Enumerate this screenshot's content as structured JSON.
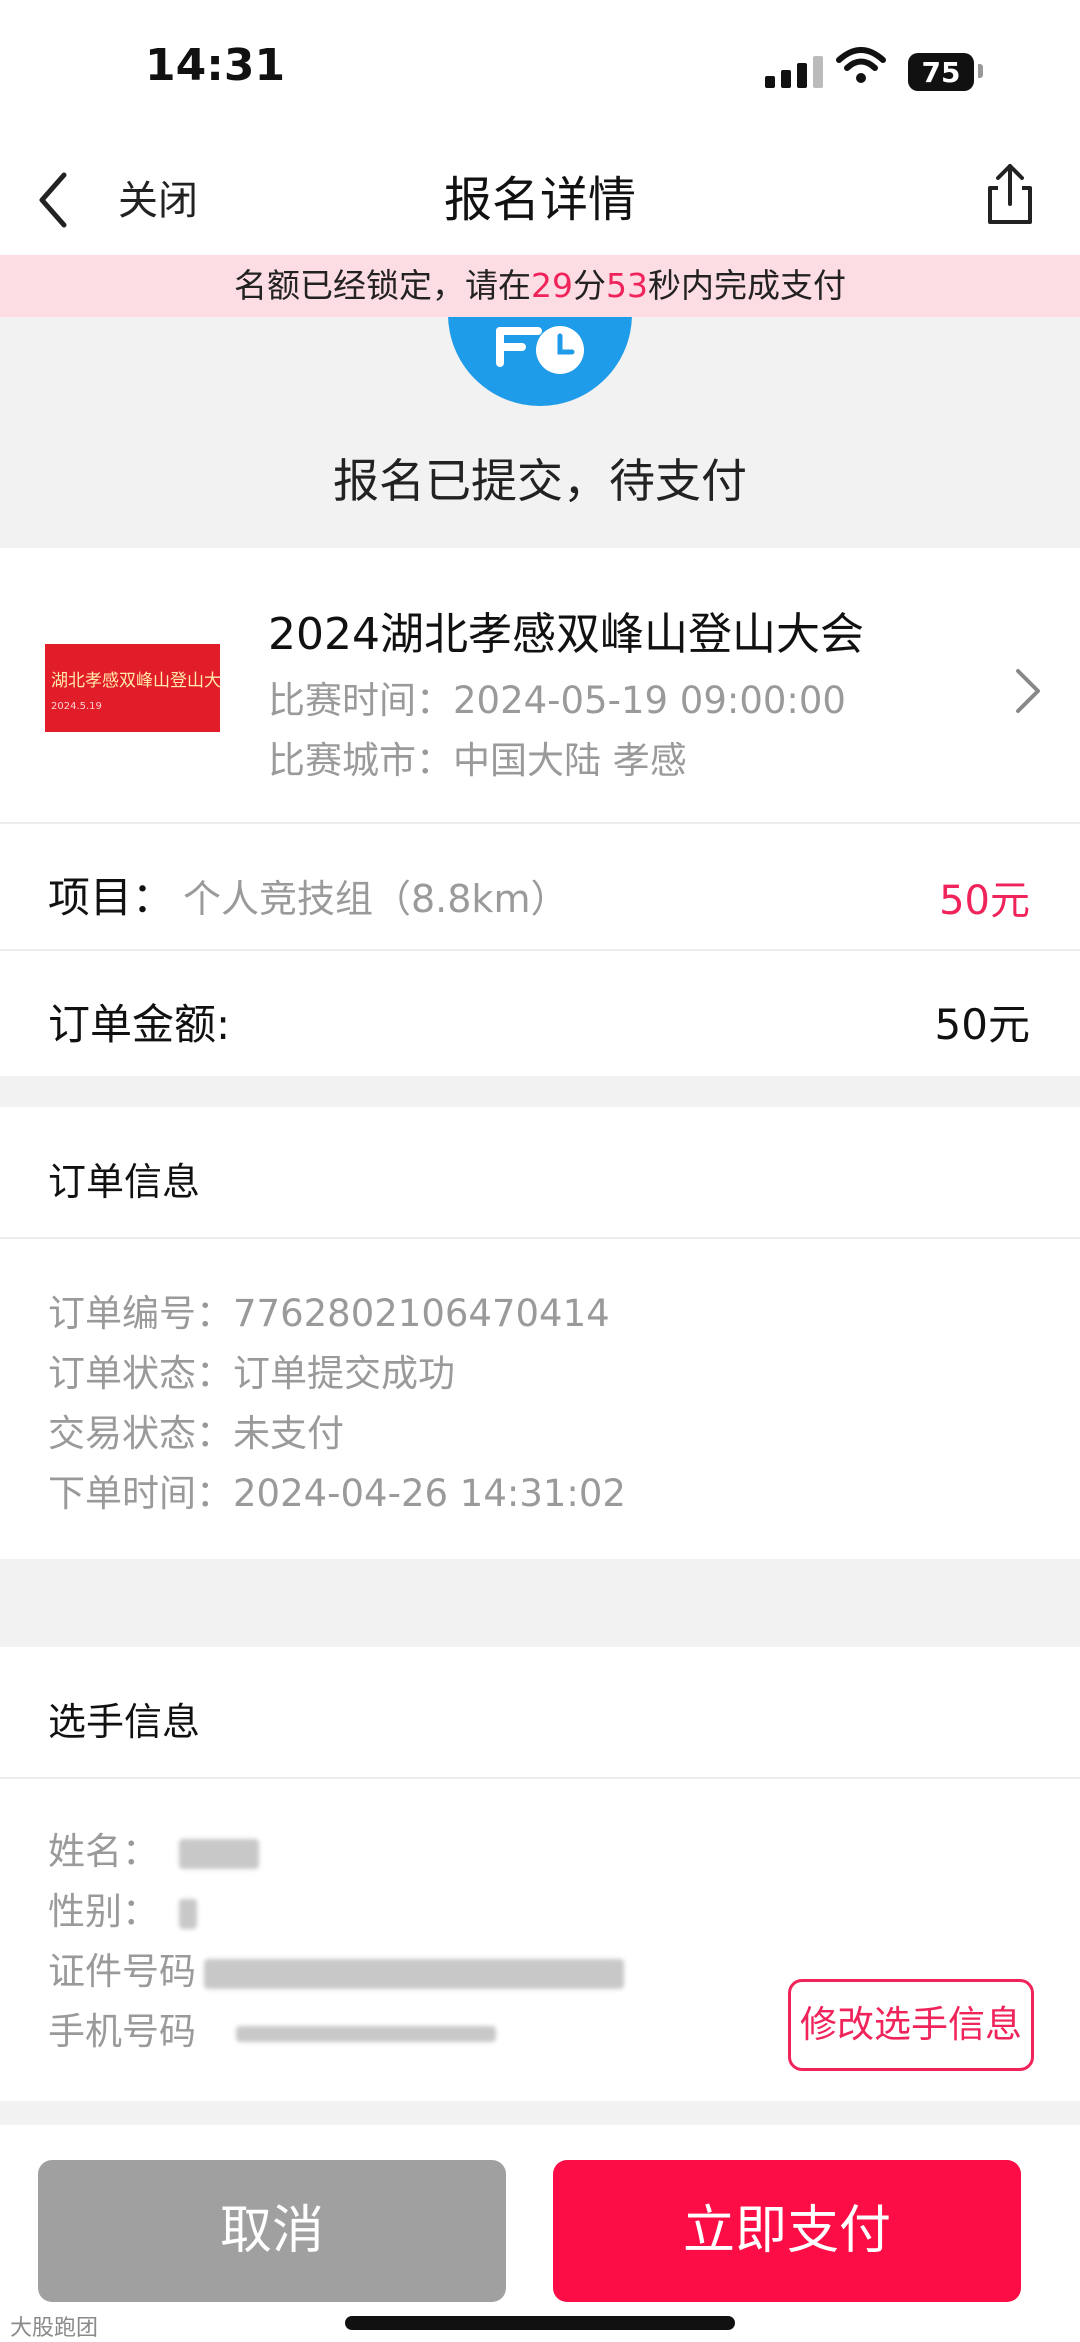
{
  "status_bar": {
    "time": "14:31",
    "battery": "75"
  },
  "nav": {
    "close_label": "关闭",
    "title": "报名详情"
  },
  "lock_banner": {
    "prefix": "名额已经锁定，请在",
    "minutes": "29",
    "min_unit": "分",
    "seconds": "53",
    "suffix": "秒内完成支付"
  },
  "status": {
    "text": "报名已提交，待支付"
  },
  "event": {
    "thumb_text": "湖北孝感双峰山登山大会",
    "thumb_date": "2024.5.19",
    "title": "2024湖北孝感双峰山登山大会",
    "time_label": "比赛时间：",
    "time_value": "2024-05-19 09:00:00",
    "city_label": "比赛城市：",
    "city_value": "中国大陆 孝感"
  },
  "item": {
    "label": "项目：",
    "name": "个人竞技组（8.8km）",
    "price": "50元"
  },
  "order_amount": {
    "label": "订单金额:",
    "value": "50元"
  },
  "order_info": {
    "title": "订单信息",
    "rows": [
      {
        "label": "订单编号：",
        "value": "7762802106470414"
      },
      {
        "label": "订单状态：",
        "value": "订单提交成功"
      },
      {
        "label": "交易状态：",
        "value": "未支付"
      },
      {
        "label": "下单时间：",
        "value": "2024-04-26 14:31:02"
      }
    ]
  },
  "player_info": {
    "title": "选手信息",
    "rows": [
      {
        "label": "姓名："
      },
      {
        "label": "性别："
      },
      {
        "label": "证件号码"
      },
      {
        "label": "手机号码"
      }
    ],
    "edit_button": "修改选手信息"
  },
  "actions": {
    "cancel": "取消",
    "pay": "立即支付"
  },
  "watermark": "大股跑团",
  "colors": {
    "accent": "#fc0d45",
    "price_red": "#f0245a",
    "banner_bg": "#fcdde4",
    "icon_blue": "#1e9be9",
    "cancel_gray": "#a0a0a0"
  }
}
